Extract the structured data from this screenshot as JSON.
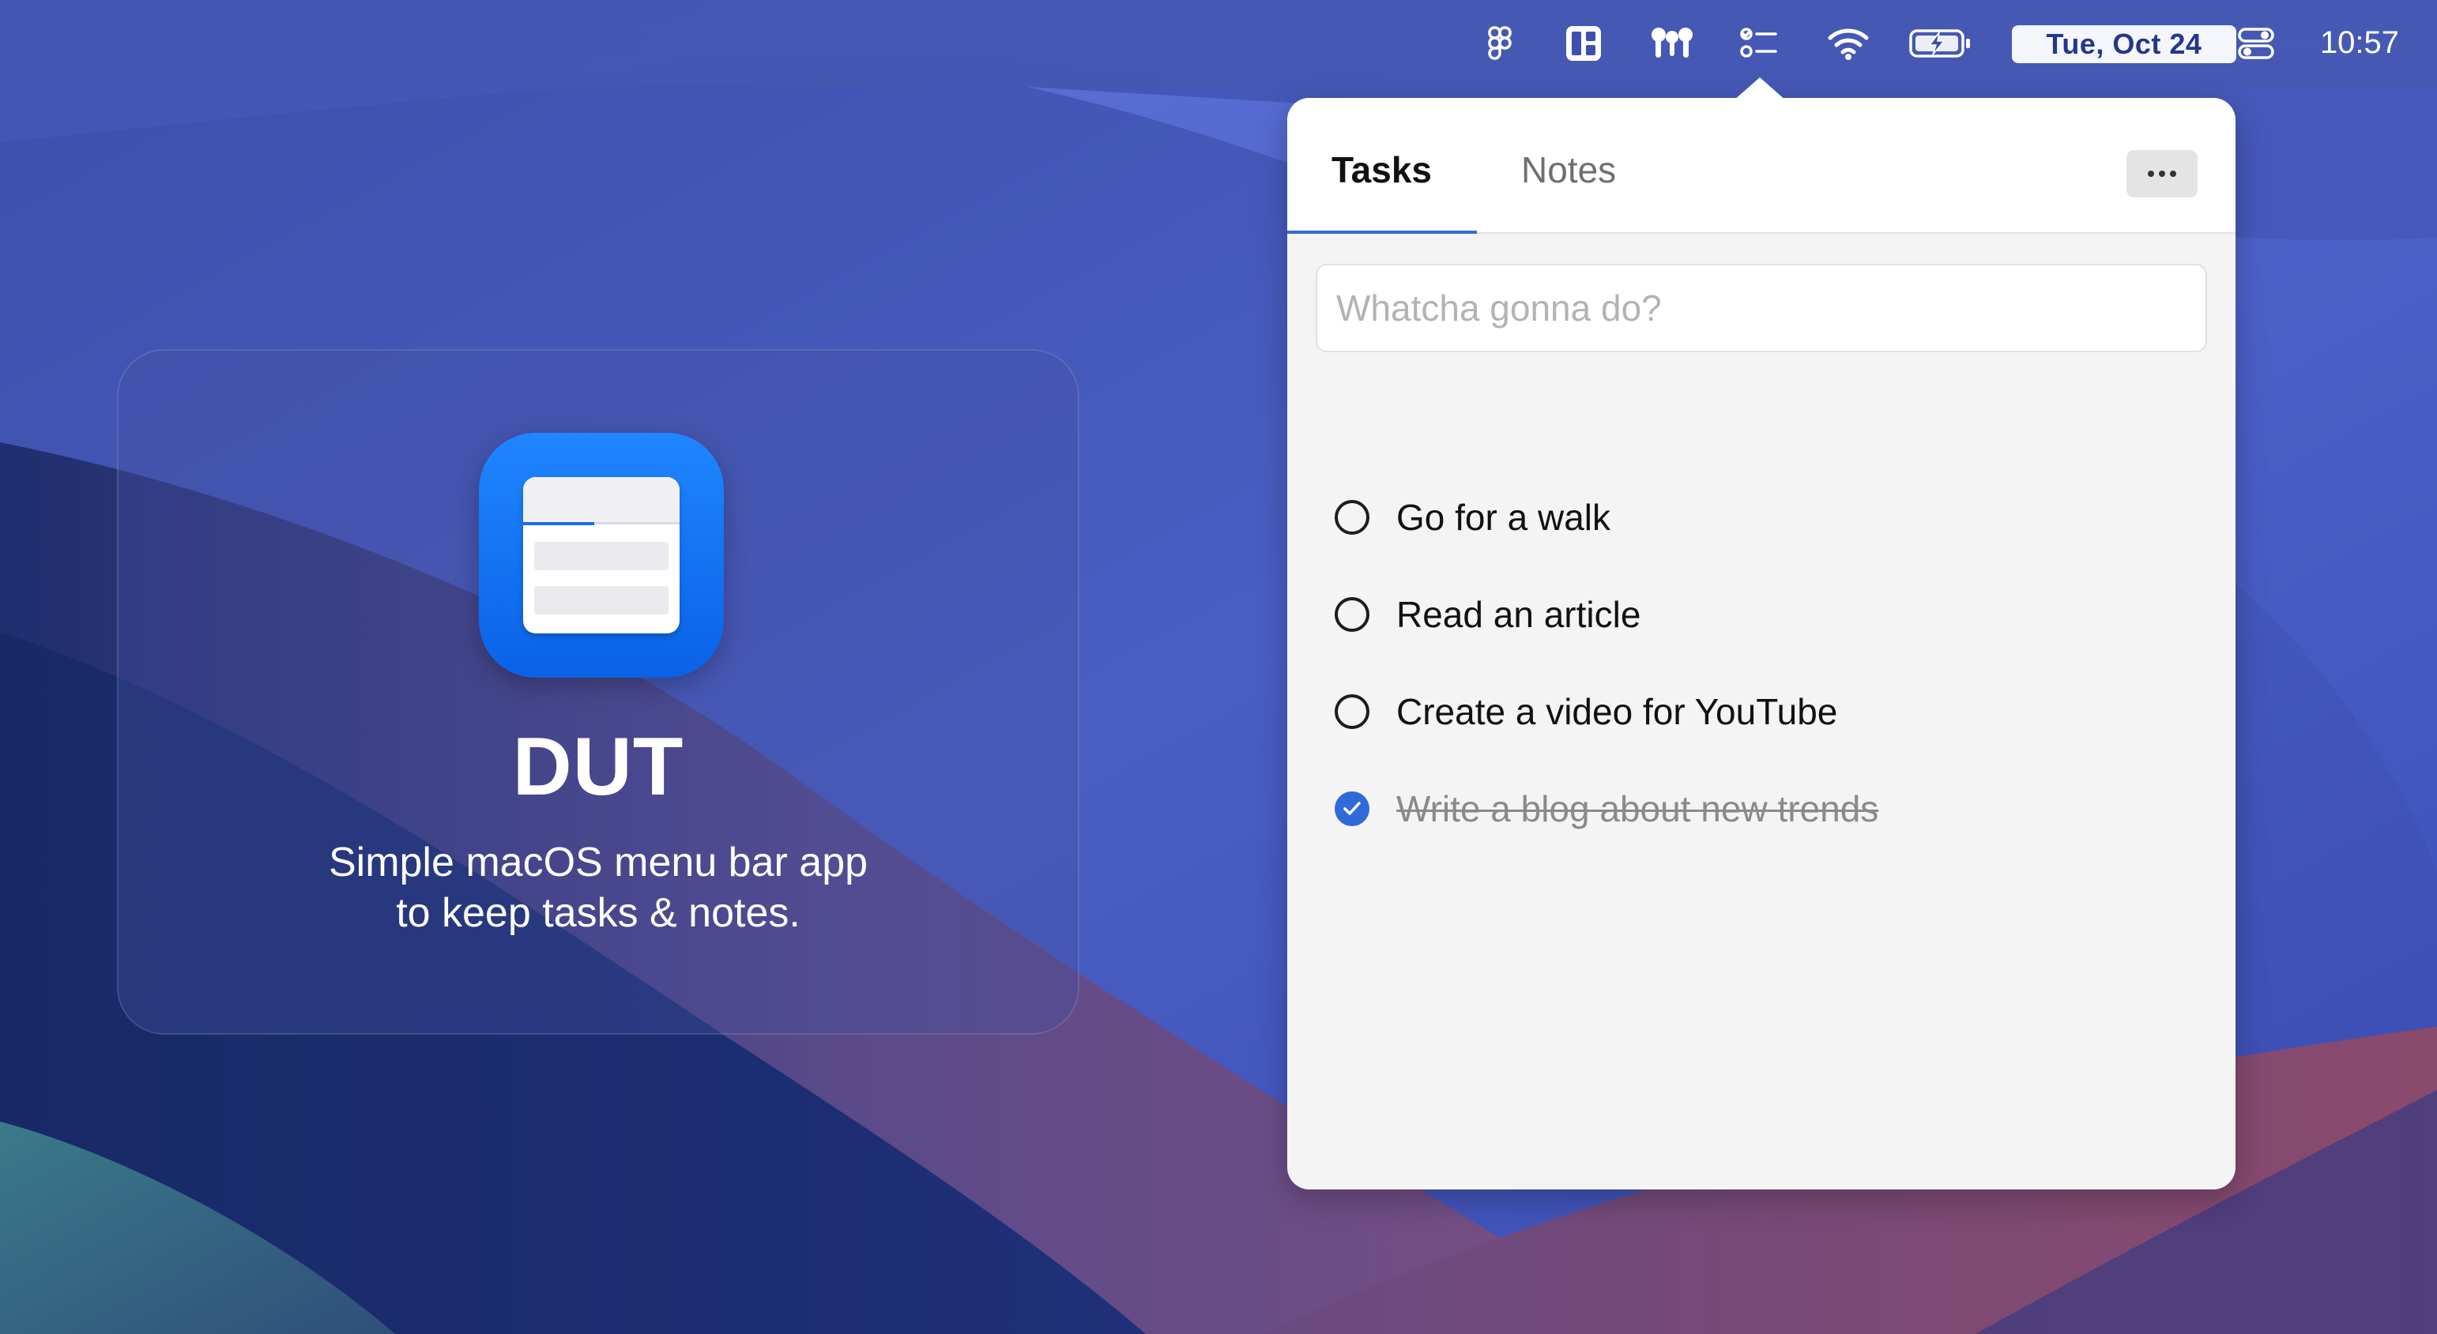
{
  "menubar": {
    "date": "Tue, Oct 24",
    "time": "10:57",
    "icons": [
      "figma-icon",
      "layout-icon",
      "airpods-icon",
      "tasks-icon",
      "wifi-icon",
      "battery-charging-icon",
      "control-center-icon"
    ]
  },
  "promo": {
    "title": "DUT",
    "subtitle": "Simple macOS menu bar app\nto keep tasks & notes."
  },
  "popover": {
    "tabs": [
      {
        "label": "Tasks",
        "active": true
      },
      {
        "label": "Notes",
        "active": false
      }
    ],
    "input_placeholder": "Whatcha gonna do?",
    "input_value": "",
    "accent_color": "#2f6bd8",
    "tasks": [
      {
        "label": "Go for a walk",
        "done": false
      },
      {
        "label": "Read an article",
        "done": false
      },
      {
        "label": "Create a video for YouTube",
        "done": false
      },
      {
        "label": "Write a blog about new trends",
        "done": true
      }
    ]
  }
}
